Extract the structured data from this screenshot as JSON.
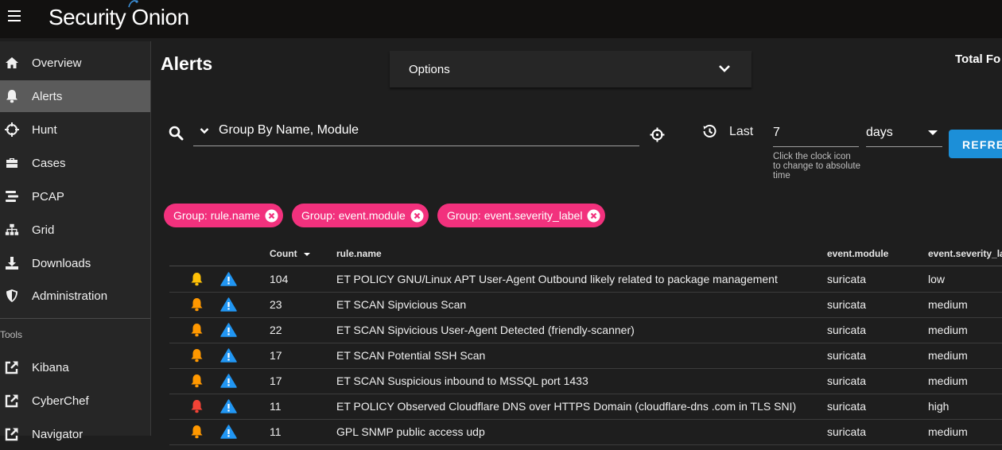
{
  "app": {
    "brand": "Security Onion"
  },
  "sidebar": {
    "items": [
      {
        "label": "Overview",
        "icon": "home-icon"
      },
      {
        "label": "Alerts",
        "icon": "bell-icon",
        "active": true
      },
      {
        "label": "Hunt",
        "icon": "crosshairs-icon"
      },
      {
        "label": "Cases",
        "icon": "briefcase-icon"
      },
      {
        "label": "PCAP",
        "icon": "stream-icon"
      },
      {
        "label": "Grid",
        "icon": "sitemap-icon"
      },
      {
        "label": "Downloads",
        "icon": "download-icon"
      },
      {
        "label": "Administration",
        "icon": "shield-icon"
      }
    ],
    "tools_header": "Tools",
    "tools": [
      {
        "label": "Kibana",
        "icon": "external-link-icon"
      },
      {
        "label": "CyberChef",
        "icon": "external-link-icon"
      },
      {
        "label": "Navigator",
        "icon": "external-link-icon"
      }
    ]
  },
  "page": {
    "title": "Alerts",
    "options_label": "Options",
    "total_label": "Total Fo"
  },
  "query": {
    "value": "Group By Name, Module",
    "last_label": "Last",
    "duration_value": "7",
    "duration_hint": "Click the clock icon to change to absolute time",
    "unit_value": "days",
    "refresh_label": "REFRE"
  },
  "chips": [
    {
      "label": "Group: rule.name"
    },
    {
      "label": "Group: event.module"
    },
    {
      "label": "Group: event.severity_label"
    }
  ],
  "table": {
    "headers": {
      "count": "Count",
      "rule": "rule.name",
      "module": "event.module",
      "severity": "event.severity_la"
    },
    "rows": [
      {
        "count": "104",
        "rule": "ET POLICY GNU/Linux APT User-Agent Outbound likely related to package management",
        "module": "suricata",
        "severity": "low",
        "bell_color": "#ffc107"
      },
      {
        "count": "23",
        "rule": "ET SCAN Sipvicious Scan",
        "module": "suricata",
        "severity": "medium",
        "bell_color": "#ff9800"
      },
      {
        "count": "22",
        "rule": "ET SCAN Sipvicious User-Agent Detected (friendly-scanner)",
        "module": "suricata",
        "severity": "medium",
        "bell_color": "#ff9800"
      },
      {
        "count": "17",
        "rule": "ET SCAN Potential SSH Scan",
        "module": "suricata",
        "severity": "medium",
        "bell_color": "#ff9800"
      },
      {
        "count": "17",
        "rule": "ET SCAN Suspicious inbound to MSSQL port 1433",
        "module": "suricata",
        "severity": "medium",
        "bell_color": "#ff9800"
      },
      {
        "count": "11",
        "rule": "ET POLICY Observed Cloudflare DNS over HTTPS Domain (cloudflare-dns .com in TLS SNI)",
        "module": "suricata",
        "severity": "high",
        "bell_color": "#f44336"
      },
      {
        "count": "11",
        "rule": "GPL SNMP public access udp",
        "module": "suricata",
        "severity": "medium",
        "bell_color": "#ff9800"
      }
    ]
  },
  "colors": {
    "chip": "#f2317d",
    "refresh": "#1c8fd8",
    "escalate": "#2196f3"
  }
}
